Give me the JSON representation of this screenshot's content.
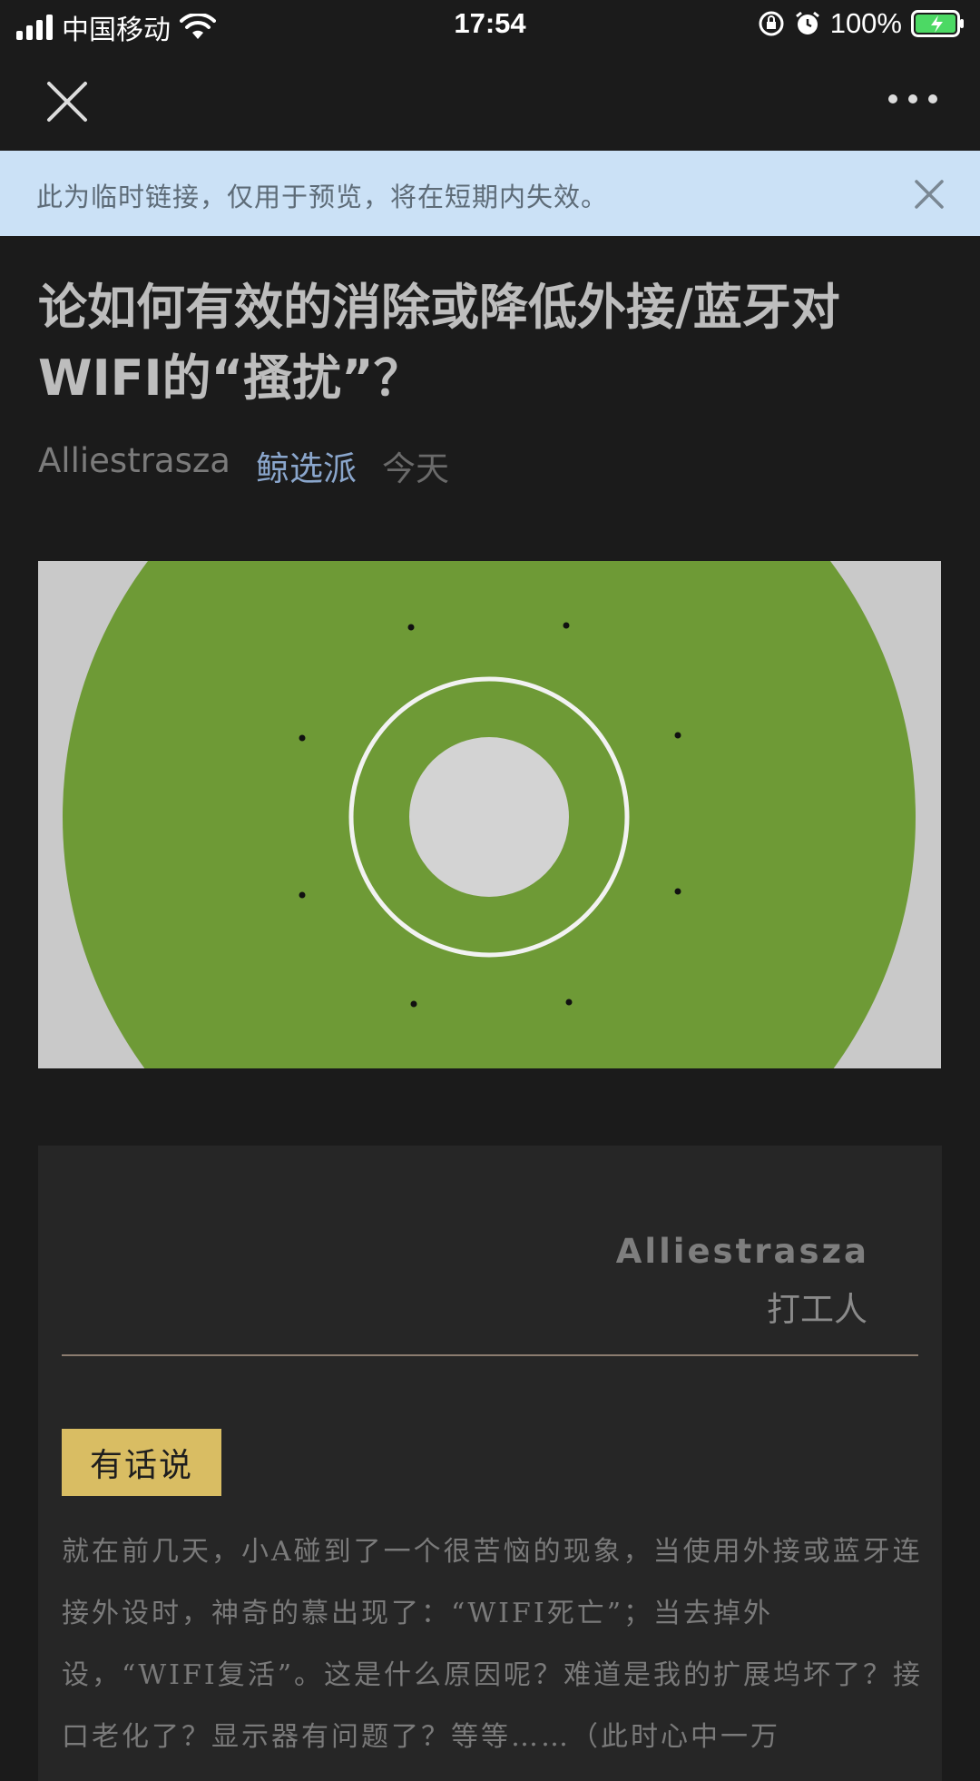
{
  "status_bar": {
    "carrier": "中国移动",
    "time": "17:54",
    "battery": "100%"
  },
  "notice": {
    "text": "此为临时链接，仅用于预览，将在短期内失效。"
  },
  "article": {
    "title": "论如何有效的消除或降低外接/蓝牙对WIFI的“搔扰”？",
    "author": "Alliestrasza",
    "channel": "鲸选派",
    "date": "今天"
  },
  "card": {
    "author": "Alliestrasza",
    "role": "打工人",
    "tag": "有话说",
    "body": "就在前几天，小A碰到了一个很苦恼的现象，当使用外接或蓝牙连接外设时，神奇的慕出现了：“WIFI死亡”；当去掉外设，“WIFI复活”。这是什么原因呢？难道是我的扩展坞坏了？接口老化了？显示器有问题了？等等……（此时心中一万"
  },
  "icons": {
    "close": "close-icon",
    "more": "more-dots-icon",
    "notice_close": "notice-close-icon"
  },
  "colors": {
    "background": "#1b1b1b",
    "notice_bg": "#cbe1f6",
    "channel": "#8aa6cc",
    "tag_bg": "#d9bd63",
    "cover_green": "#6e9a36"
  }
}
